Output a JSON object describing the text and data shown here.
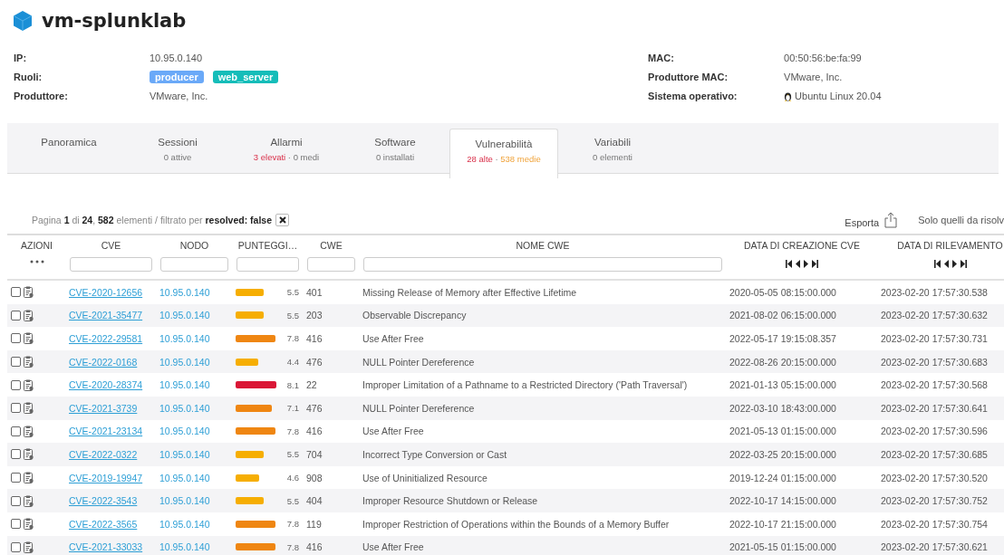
{
  "device": {
    "name": "vm-splunklab"
  },
  "info_left": [
    {
      "label": "IP:",
      "kind": "text",
      "value": "10.95.0.140"
    },
    {
      "label": "Ruoli:",
      "kind": "tags",
      "tags": [
        {
          "text": "producer",
          "color": "#6aa9f8"
        },
        {
          "text": "web_server",
          "color": "#15bdb9"
        }
      ]
    },
    {
      "label": "Produttore:",
      "kind": "text",
      "value": "VMware, Inc."
    }
  ],
  "info_right": [
    {
      "label": "MAC:",
      "kind": "text",
      "value": "00:50:56:be:fa:99"
    },
    {
      "label": "Produttore MAC:",
      "kind": "text",
      "value": "VMware, Inc."
    },
    {
      "label": "Sistema operativo:",
      "kind": "os",
      "value": "Ubuntu Linux 20.04"
    }
  ],
  "tabs": [
    {
      "label": "Panoramica",
      "selected": false
    },
    {
      "label": "Sessioni",
      "selected": false,
      "sub": [
        {
          "text": "0 attive",
          "kind": "neutral"
        }
      ]
    },
    {
      "label": "Allarmi",
      "selected": false,
      "sub": [
        {
          "text": "3 elevati",
          "kind": "high"
        },
        {
          "text": " · 0 medi",
          "kind": "neutral"
        }
      ]
    },
    {
      "label": "Software",
      "selected": false,
      "sub": [
        {
          "text": "0 installati",
          "kind": "neutral"
        }
      ]
    },
    {
      "label": "Vulnerabilità",
      "selected": true,
      "sub": [
        {
          "text": "28 alte",
          "kind": "high"
        },
        {
          "text": " · ",
          "kind": "neutral"
        },
        {
          "text": "538 medie",
          "kind": "medium"
        }
      ]
    },
    {
      "label": "Variabili",
      "selected": false,
      "sub": [
        {
          "text": "0 elementi",
          "kind": "neutral"
        }
      ]
    }
  ],
  "pagination": "Pagina **1** di **24**, **582** elementi / filtrato per **resolved: false**",
  "export": "Esporta",
  "only_unresolved": "Solo quelli da risolv",
  "columns": [
    {
      "label": "AZIONI",
      "kind": "menu"
    },
    {
      "label": "CVE",
      "kind": "text"
    },
    {
      "label": "NODO",
      "kind": "text"
    },
    {
      "label": "PUNTEGGI…",
      "kind": "text"
    },
    {
      "label": "CWE",
      "kind": "text"
    },
    {
      "label": "NOME CWE",
      "kind": "text"
    },
    {
      "label": "DATA DI CREAZIONE CVE",
      "kind": "nav"
    },
    {
      "label": "DATA DI RILEVAMENTO",
      "kind": "nav"
    }
  ],
  "rows": [
    {
      "checked": false,
      "cve": "CVE-2020-12656",
      "node": "10.95.0.140",
      "color": "#f6ae02",
      "score": "5.5",
      "cwe": "401",
      "cwe_name": "Missing Release of Memory after Effective Lifetime",
      "created": "2020-05-05 08:15:00.000",
      "detected": "2023-02-20 17:57:30.538"
    },
    {
      "checked": false,
      "cve": "CVE-2021-35477",
      "node": "10.95.0.140",
      "color": "#f6ae02",
      "score": "5.5",
      "cwe": "203",
      "cwe_name": "Observable Discrepancy",
      "created": "2021-08-02 06:15:00.000",
      "detected": "2023-02-20 17:57:30.632"
    },
    {
      "checked": false,
      "cve": "CVE-2022-29581",
      "node": "10.95.0.140",
      "color": "#ef8612",
      "score": "7.8",
      "cwe": "416",
      "cwe_name": "Use After Free",
      "created": "2022-05-17 19:15:08.357",
      "detected": "2023-02-20 17:57:30.731"
    },
    {
      "checked": false,
      "cve": "CVE-2022-0168",
      "node": "10.95.0.140",
      "color": "#f6ae02",
      "score": "4.4",
      "cwe": "476",
      "cwe_name": "NULL Pointer Dereference",
      "created": "2022-08-26 20:15:00.000",
      "detected": "2023-02-20 17:57:30.683"
    },
    {
      "checked": false,
      "cve": "CVE-2020-28374",
      "node": "10.95.0.140",
      "color": "#da1736",
      "score": "8.1",
      "cwe": "22",
      "cwe_name": "Improper Limitation of a Pathname to a Restricted Directory ('Path Traversal')",
      "created": "2021-01-13 05:15:00.000",
      "detected": "2023-02-20 17:57:30.568"
    },
    {
      "checked": false,
      "cve": "CVE-2021-3739",
      "node": "10.95.0.140",
      "color": "#ef8612",
      "score": "7.1",
      "cwe": "476",
      "cwe_name": "NULL Pointer Dereference",
      "created": "2022-03-10 18:43:00.000",
      "detected": "2023-02-20 17:57:30.641"
    },
    {
      "checked": false,
      "cve": "CVE-2021-23134",
      "node": "10.95.0.140",
      "color": "#ef8612",
      "score": "7.8",
      "cwe": "416",
      "cwe_name": "Use After Free",
      "created": "2021-05-13 01:15:00.000",
      "detected": "2023-02-20 17:57:30.596"
    },
    {
      "checked": false,
      "cve": "CVE-2022-0322",
      "node": "10.95.0.140",
      "color": "#f6ae02",
      "score": "5.5",
      "cwe": "704",
      "cwe_name": "Incorrect Type Conversion or Cast",
      "created": "2022-03-25 20:15:00.000",
      "detected": "2023-02-20 17:57:30.685"
    },
    {
      "checked": false,
      "cve": "CVE-2019-19947",
      "node": "10.95.0.140",
      "color": "#f6ae02",
      "score": "4.6",
      "cwe": "908",
      "cwe_name": "Use of Uninitialized Resource",
      "created": "2019-12-24 01:15:00.000",
      "detected": "2023-02-20 17:57:30.520"
    },
    {
      "checked": false,
      "cve": "CVE-2022-3543",
      "node": "10.95.0.140",
      "color": "#f6ae02",
      "score": "5.5",
      "cwe": "404",
      "cwe_name": "Improper Resource Shutdown or Release",
      "created": "2022-10-17 14:15:00.000",
      "detected": "2023-02-20 17:57:30.752"
    },
    {
      "checked": false,
      "cve": "CVE-2022-3565",
      "node": "10.95.0.140",
      "color": "#ef8612",
      "score": "7.8",
      "cwe": "119",
      "cwe_name": "Improper Restriction of Operations within the Bounds of a Memory Buffer",
      "created": "2022-10-17 21:15:00.000",
      "detected": "2023-02-20 17:57:30.754"
    },
    {
      "checked": false,
      "cve": "CVE-2021-33033",
      "node": "10.95.0.140",
      "color": "#ef8612",
      "score": "7.8",
      "cwe": "416",
      "cwe_name": "Use After Free",
      "created": "2021-05-15 01:15:00.000",
      "detected": "2023-02-20 17:57:30.621"
    }
  ]
}
